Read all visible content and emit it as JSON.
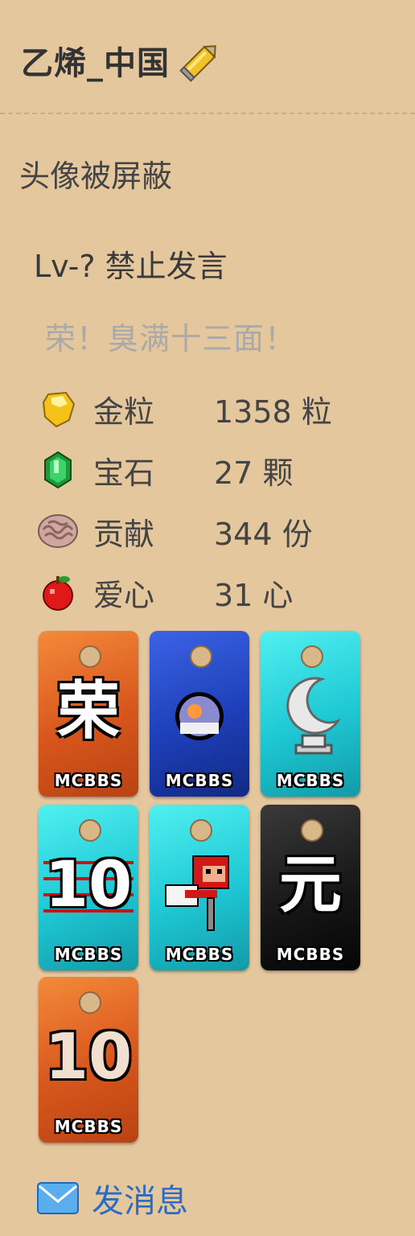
{
  "profile": {
    "username": "乙烯_中国",
    "edit_icon": "pencil-icon",
    "avatar_notice": "头像被屏蔽",
    "level": "Lv-? 禁止发言",
    "slogan": "荣！臭满十三面！"
  },
  "stats": [
    {
      "icon": "gold-nugget-icon",
      "label": "金粒",
      "value": "1358 粒"
    },
    {
      "icon": "emerald-icon",
      "label": "宝石",
      "value": "27 颗"
    },
    {
      "icon": "brain-icon",
      "label": "贡献",
      "value": "344 份"
    },
    {
      "icon": "apple-icon",
      "label": "爱心",
      "value": "31 心"
    }
  ],
  "medals": [
    {
      "name": "medal-rong",
      "glyph": "荣",
      "brand": "MCBBS",
      "color": "#e06a28"
    },
    {
      "name": "medal-purple-orb",
      "glyph": "",
      "brand": "MCBBS",
      "color": "#2a4fd0"
    },
    {
      "name": "medal-moon-trophy",
      "glyph": "",
      "brand": "MCBBS",
      "color": "#28d8e0"
    },
    {
      "name": "medal-ten",
      "glyph": "10",
      "brand": "MCBBS",
      "color": "#28d8e0"
    },
    {
      "name": "medal-red-sheep",
      "glyph": "",
      "brand": "MCBBS",
      "color": "#28d8e0"
    },
    {
      "name": "medal-yuan",
      "glyph": "元",
      "brand": "MCBBS",
      "color": "#111111"
    },
    {
      "name": "medal-ten-years",
      "glyph": "10",
      "brand": "MCBBS",
      "color": "#e06a28"
    }
  ],
  "actions": {
    "send_message": "发消息",
    "send_message_icon": "mail-icon"
  },
  "colors": {
    "background": "#e5c79e",
    "link": "#2a6cc4",
    "muted": "#a9a9a9"
  }
}
